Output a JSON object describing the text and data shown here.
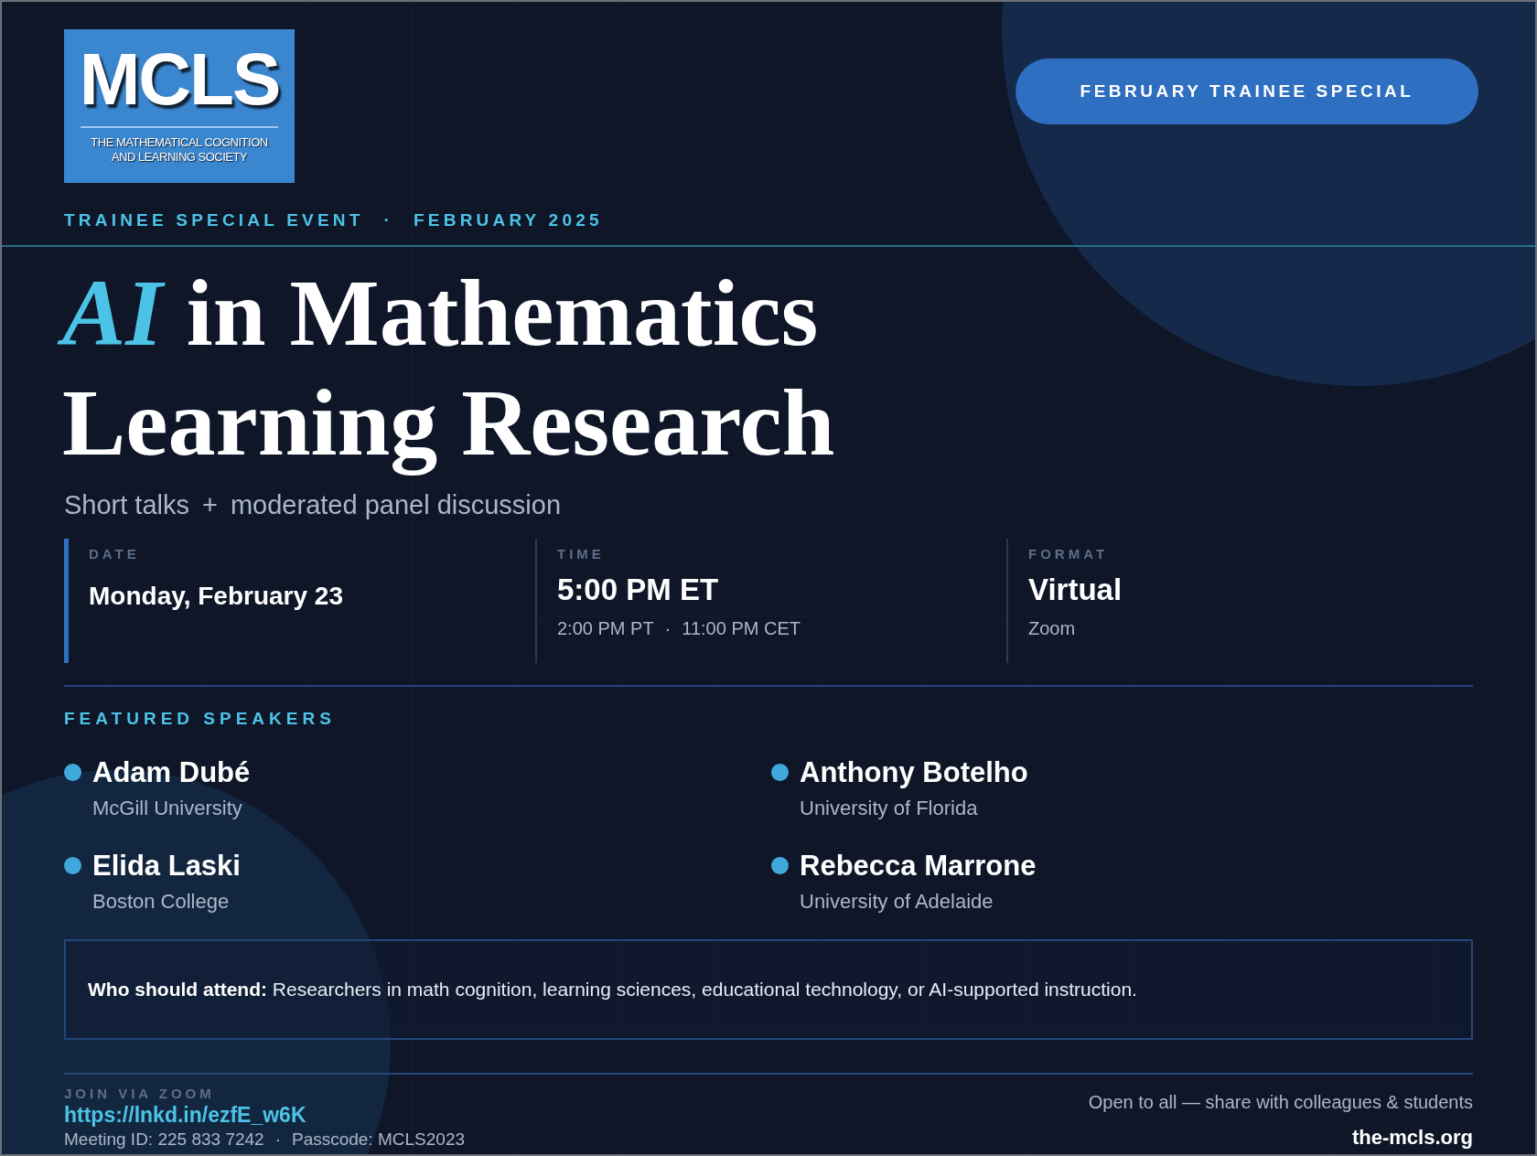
{
  "logo": {
    "mark": "MCLS",
    "tagline_lines": [
      "THE MATHEMATICAL COGNITION",
      "AND LEARNING SOCIETY"
    ]
  },
  "badge": "FEBRUARY TRAINEE SPECIAL",
  "kicker": [
    "TRAINEE SPECIAL EVENT",
    "·",
    "FEBRUARY 2025"
  ],
  "title_lines": [
    "*AI* in Mathematics",
    "Learning Research"
  ],
  "subtitle": [
    "Short talks",
    "+",
    "moderated panel discussion"
  ],
  "details": [
    {
      "label": "DATE",
      "value": "Monday, February 23",
      "highlight": true
    },
    {
      "label": "TIME",
      "value": "5:00 PM ET",
      "notes": [
        "2:00 PM PT",
        "·",
        "11:00 PM CET"
      ],
      "highlight": false
    },
    {
      "label": "FORMAT",
      "value": "Virtual",
      "notes": [
        "Zoom"
      ],
      "highlight": false
    }
  ],
  "speakers_heading": "FEATURED SPEAKERS",
  "speakers": [
    {
      "name": "Adam Dubé",
      "affiliation": "McGill University"
    },
    {
      "name": "Anthony Botelho",
      "affiliation": "University of Florida"
    },
    {
      "name": "Elida Laski",
      "affiliation": "Boston College"
    },
    {
      "name": "Rebecca Marrone",
      "affiliation": "University of Adelaide"
    }
  ],
  "audience_note": "**Who should attend:** Researchers in math cognition, learning sciences, educational technology, or AI-supported instruction.",
  "footer": {
    "join_label": "JOIN VIA ZOOM",
    "link": "https://lnkd.in/ezfE_w6K",
    "meeting": [
      "Meeting ID: 225 833 7242",
      "·",
      "Passcode: MCLS2023"
    ],
    "share_note": "Open to all — share with colleagues & students",
    "site": "the-mcls.org"
  }
}
